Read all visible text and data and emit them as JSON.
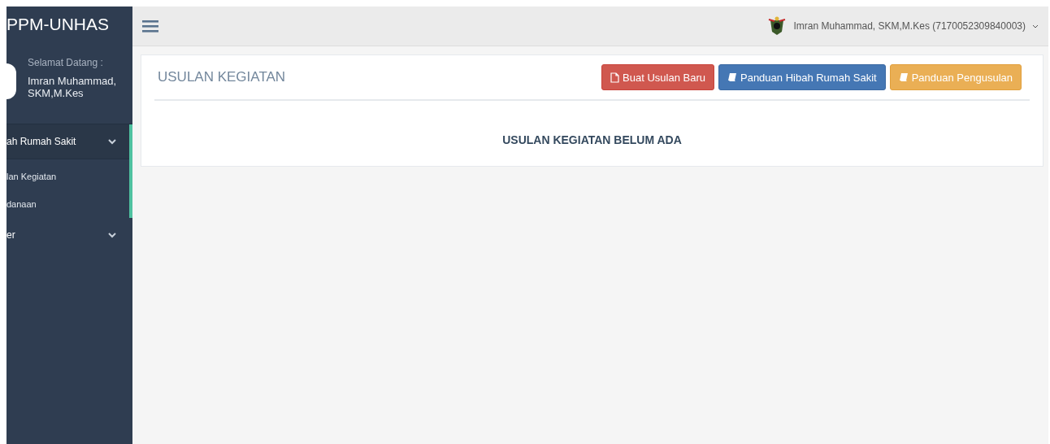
{
  "sidebar": {
    "brand": "PPM-UNHAS",
    "welcome": "Selamat Datang :",
    "user_name": "Imran Muhammad, SKM,M.Kes",
    "menu": [
      {
        "label": "ah Rumah Sakit",
        "expanded": true,
        "children": [
          {
            "label": "lan Kegiatan"
          },
          {
            "label": "danaan"
          }
        ]
      },
      {
        "label": "er",
        "expanded": false
      }
    ]
  },
  "topbar": {
    "user": "Imran Muhammad, SKM,M.Kes (7170052309840003)"
  },
  "panel": {
    "title": "USULAN KEGIATAN",
    "buttons": [
      {
        "label": "Buat Usulan Baru",
        "kind": "danger"
      },
      {
        "label": "Panduan Hibah Rumah Sakit",
        "kind": "primary"
      },
      {
        "label": "Panduan Pengusulan",
        "kind": "warning"
      }
    ],
    "message": "USULAN KEGIATAN BELUM ADA"
  }
}
